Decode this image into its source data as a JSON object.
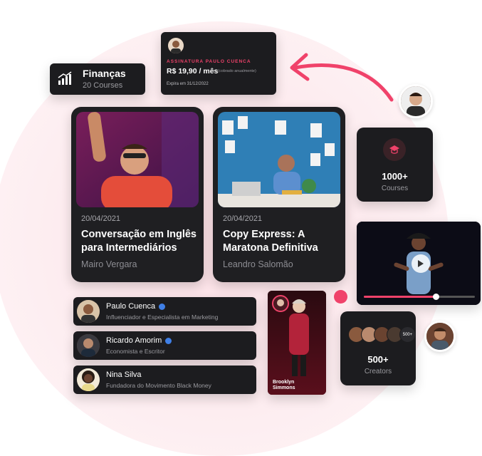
{
  "finance": {
    "title": "Finanças",
    "subtitle": "20 Courses",
    "icon": "bar-chart-icon"
  },
  "subscription": {
    "label": "ASSINATURA PAULO CUENCA",
    "price": "R$ 19,90 / mês",
    "note": "(cobrado anualmente)",
    "expiry": "Expira em 31/12/2022"
  },
  "courses": [
    {
      "date": "20/04/2021",
      "title": "Conversação em Inglês para Intermediários",
      "author": "Mairo Vergara"
    },
    {
      "date": "20/04/2021",
      "title": "Copy Express: A Maratona Definitiva",
      "author": "Leandro Salomão"
    }
  ],
  "courses_stat": {
    "count": "1000+",
    "label": "Courses",
    "icon": "graduation-cap-icon"
  },
  "video": {
    "progress": 0.65
  },
  "creators": [
    {
      "name": "Paulo Cuenca",
      "role": "Influenciador e Especialista em Marketing",
      "verified": true
    },
    {
      "name": "Ricardo Amorim",
      "role": "Economista e Escritor",
      "verified": true
    },
    {
      "name": "Nina Silva",
      "role": "Fundadora do Movimento Black Money",
      "verified": false
    }
  ],
  "speaker": {
    "name_line1": "Brooklyn",
    "name_line2": "Simmons"
  },
  "creators_stat": {
    "count": "500+",
    "label": "Creators",
    "badge": "500+"
  },
  "colors": {
    "accent": "#f0426a",
    "card": "#1c1c1f",
    "background_blob": "#fde1e7"
  }
}
